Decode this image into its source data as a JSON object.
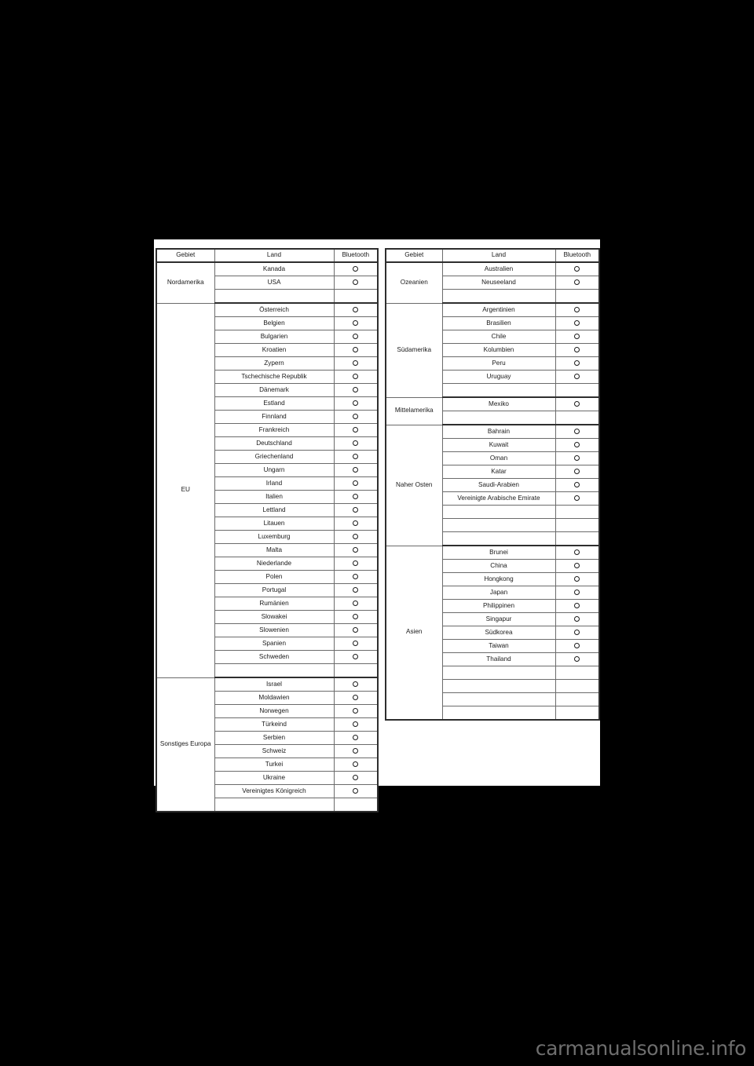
{
  "page": {
    "background_color": "#000000",
    "sheet_color": "#ffffff",
    "watermark": "carmanualsonline.info"
  },
  "table_left": {
    "headers": [
      "Gebiet",
      "Land",
      "Bluetooth"
    ],
    "groups": [
      {
        "region": "Nordamerika",
        "rows": [
          {
            "land": "Kanada",
            "bluetooth": "ring"
          },
          {
            "land": "USA",
            "bluetooth": "ring"
          },
          {
            "land": "",
            "bluetooth": ""
          }
        ]
      },
      {
        "region": "EU",
        "rows": [
          {
            "land": "Österreich",
            "bluetooth": "ring"
          },
          {
            "land": "Belgien",
            "bluetooth": "ring"
          },
          {
            "land": "Bulgarien",
            "bluetooth": "ring"
          },
          {
            "land": "Kroatien",
            "bluetooth": "ring"
          },
          {
            "land": "Zypern",
            "bluetooth": "ring"
          },
          {
            "land": "Tschechische Republik",
            "bluetooth": "ring"
          },
          {
            "land": "Dänemark",
            "bluetooth": "ring"
          },
          {
            "land": "Estland",
            "bluetooth": "ring"
          },
          {
            "land": "Finnland",
            "bluetooth": "ring"
          },
          {
            "land": "Frankreich",
            "bluetooth": "ring"
          },
          {
            "land": "Deutschland",
            "bluetooth": "ring"
          },
          {
            "land": "Griechenland",
            "bluetooth": "ring"
          },
          {
            "land": "Ungarn",
            "bluetooth": "ring"
          },
          {
            "land": "Irland",
            "bluetooth": "ring"
          },
          {
            "land": "Italien",
            "bluetooth": "ring"
          },
          {
            "land": "Lettland",
            "bluetooth": "ring"
          },
          {
            "land": "Litauen",
            "bluetooth": "ring"
          },
          {
            "land": "Luxemburg",
            "bluetooth": "ring"
          },
          {
            "land": "Malta",
            "bluetooth": "ring"
          },
          {
            "land": "Niederlande",
            "bluetooth": "ring"
          },
          {
            "land": "Polen",
            "bluetooth": "ring"
          },
          {
            "land": "Portugal",
            "bluetooth": "ring"
          },
          {
            "land": "Rumänien",
            "bluetooth": "ring"
          },
          {
            "land": "Slowakei",
            "bluetooth": "ring"
          },
          {
            "land": "Slowenien",
            "bluetooth": "ring"
          },
          {
            "land": "Spanien",
            "bluetooth": "ring"
          },
          {
            "land": "Schweden",
            "bluetooth": "ring"
          },
          {
            "land": "",
            "bluetooth": ""
          }
        ]
      },
      {
        "region": "Sonstiges Europa",
        "rows": [
          {
            "land": "Israel",
            "bluetooth": "ring"
          },
          {
            "land": "Moldawien",
            "bluetooth": "ring"
          },
          {
            "land": "Norwegen",
            "bluetooth": "ring"
          },
          {
            "land": "Türkeind",
            "bluetooth": "ring"
          },
          {
            "land": "Serbien",
            "bluetooth": "ring"
          },
          {
            "land": "Schweiz",
            "bluetooth": "ring"
          },
          {
            "land": "Turkei",
            "bluetooth": "ring"
          },
          {
            "land": "Ukraine",
            "bluetooth": "ring"
          },
          {
            "land": "Vereinigtes Königreich",
            "bluetooth": "ring"
          },
          {
            "land": "",
            "bluetooth": ""
          }
        ]
      }
    ]
  },
  "table_right": {
    "headers": [
      "Gebiet",
      "Land",
      "Bluetooth"
    ],
    "groups": [
      {
        "region": "Ozeanien",
        "rows": [
          {
            "land": "Australien",
            "bluetooth": "ring"
          },
          {
            "land": "Neuseeland",
            "bluetooth": "ring"
          },
          {
            "land": "",
            "bluetooth": ""
          }
        ]
      },
      {
        "region": "Südamerika",
        "rows": [
          {
            "land": "Argentinien",
            "bluetooth": "ring"
          },
          {
            "land": "Brasilien",
            "bluetooth": "ring"
          },
          {
            "land": "Chile",
            "bluetooth": "ring"
          },
          {
            "land": "Kolumbien",
            "bluetooth": "ring"
          },
          {
            "land": "Peru",
            "bluetooth": "ring"
          },
          {
            "land": "Uruguay",
            "bluetooth": "ring"
          },
          {
            "land": "",
            "bluetooth": ""
          }
        ]
      },
      {
        "region": "Mittelamerika",
        "rows": [
          {
            "land": "Mexiko",
            "bluetooth": "ring"
          },
          {
            "land": "",
            "bluetooth": ""
          }
        ]
      },
      {
        "region": "Naher Osten",
        "rows": [
          {
            "land": "Bahrain",
            "bluetooth": "ring"
          },
          {
            "land": "Kuwait",
            "bluetooth": "ring"
          },
          {
            "land": "Oman",
            "bluetooth": "ring"
          },
          {
            "land": "Katar",
            "bluetooth": "ring"
          },
          {
            "land": "Saudi-Arabien",
            "bluetooth": "ring"
          },
          {
            "land": "Vereinigte Arabische Emirate",
            "bluetooth": "ring"
          },
          {
            "land": "",
            "bluetooth": ""
          },
          {
            "land": "",
            "bluetooth": ""
          },
          {
            "land": "",
            "bluetooth": ""
          }
        ]
      },
      {
        "region": "Asien",
        "rows": [
          {
            "land": "Brunei",
            "bluetooth": "ring"
          },
          {
            "land": "China",
            "bluetooth": "ring"
          },
          {
            "land": "Hongkong",
            "bluetooth": "ring"
          },
          {
            "land": "Japan",
            "bluetooth": "ring"
          },
          {
            "land": "Philippinen",
            "bluetooth": "ring"
          },
          {
            "land": "Singapur",
            "bluetooth": "ring"
          },
          {
            "land": "Südkorea",
            "bluetooth": "ring"
          },
          {
            "land": "Taiwan",
            "bluetooth": "ring"
          },
          {
            "land": "Thailand",
            "bluetooth": "ring"
          },
          {
            "land": "",
            "bluetooth": ""
          },
          {
            "land": "",
            "bluetooth": ""
          },
          {
            "land": "",
            "bluetooth": ""
          },
          {
            "land": "",
            "bluetooth": ""
          }
        ]
      }
    ]
  }
}
